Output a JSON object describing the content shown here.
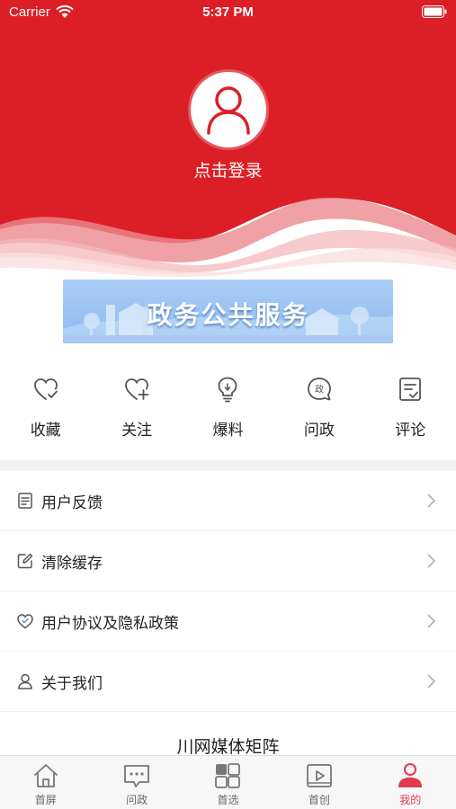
{
  "status_bar": {
    "carrier": "Carrier",
    "time": "5:37 PM"
  },
  "header": {
    "login_text": "点击登录",
    "brand_color": "#dc1f26"
  },
  "banner": {
    "text": "政务公共服务"
  },
  "quick_actions": [
    {
      "label": "收藏",
      "icon": "heart-check-icon"
    },
    {
      "label": "关注",
      "icon": "heart-plus-icon"
    },
    {
      "label": "爆料",
      "icon": "lightbulb-icon"
    },
    {
      "label": "问政",
      "icon": "zheng-chat-icon",
      "glyph": "政"
    },
    {
      "label": "评论",
      "icon": "comment-check-icon"
    }
  ],
  "menu": [
    {
      "label": "用户反馈",
      "icon": "document-icon"
    },
    {
      "label": "清除缓存",
      "icon": "edit-icon"
    },
    {
      "label": "用户协议及隐私政策",
      "icon": "heart-shield-icon"
    },
    {
      "label": "关于我们",
      "icon": "user-icon"
    }
  ],
  "matrix_title": "川网媒体矩阵",
  "tabbar": {
    "active_color": "#e03a4e",
    "tabs": [
      {
        "label": "首屏",
        "icon": "home-icon"
      },
      {
        "label": "问政",
        "icon": "chat-bubble-icon"
      },
      {
        "label": "首选",
        "icon": "grid-icon"
      },
      {
        "label": "首创",
        "icon": "video-icon"
      },
      {
        "label": "我的",
        "icon": "profile-icon"
      }
    ]
  }
}
